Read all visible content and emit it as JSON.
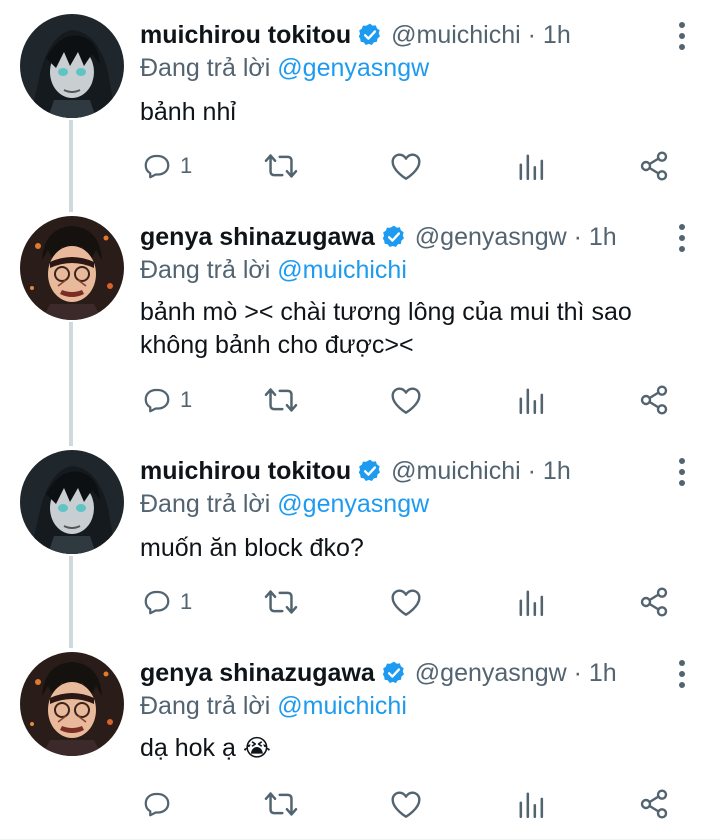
{
  "colors": {
    "accent": "#1d9bf0",
    "verified": "#1d9bf0",
    "secondary": "#536471",
    "thread": "#cfd9de"
  },
  "reply_prefix": "Đang trả lời",
  "tweets": [
    {
      "name": "muichirou tokitou",
      "handle": "@muichichi",
      "time": "· 1h",
      "reply_to": "@genyasngw",
      "text": "bảnh nhỉ",
      "emoji": "",
      "reply_count": "1",
      "avatar": "muichirou-avatar"
    },
    {
      "name": "genya shinazugawa",
      "handle": "@genyasngw",
      "time": "· 1h",
      "reply_to": "@muichichi",
      "text": "bảnh mò >< chài tương lông của mui thì sao không bảnh cho được><",
      "emoji": "",
      "reply_count": "1",
      "avatar": "genya-avatar"
    },
    {
      "name": "muichirou tokitou",
      "handle": "@muichichi",
      "time": "· 1h",
      "reply_to": "@genyasngw",
      "text": "muốn ăn block đko?",
      "emoji": "",
      "reply_count": "1",
      "avatar": "muichirou-avatar"
    },
    {
      "name": "genya shinazugawa",
      "handle": "@genyasngw",
      "time": "· 1h",
      "reply_to": "@muichichi",
      "text": "dạ hok ạ",
      "emoji": "😭",
      "reply_count": "",
      "avatar": "genya-avatar"
    }
  ]
}
